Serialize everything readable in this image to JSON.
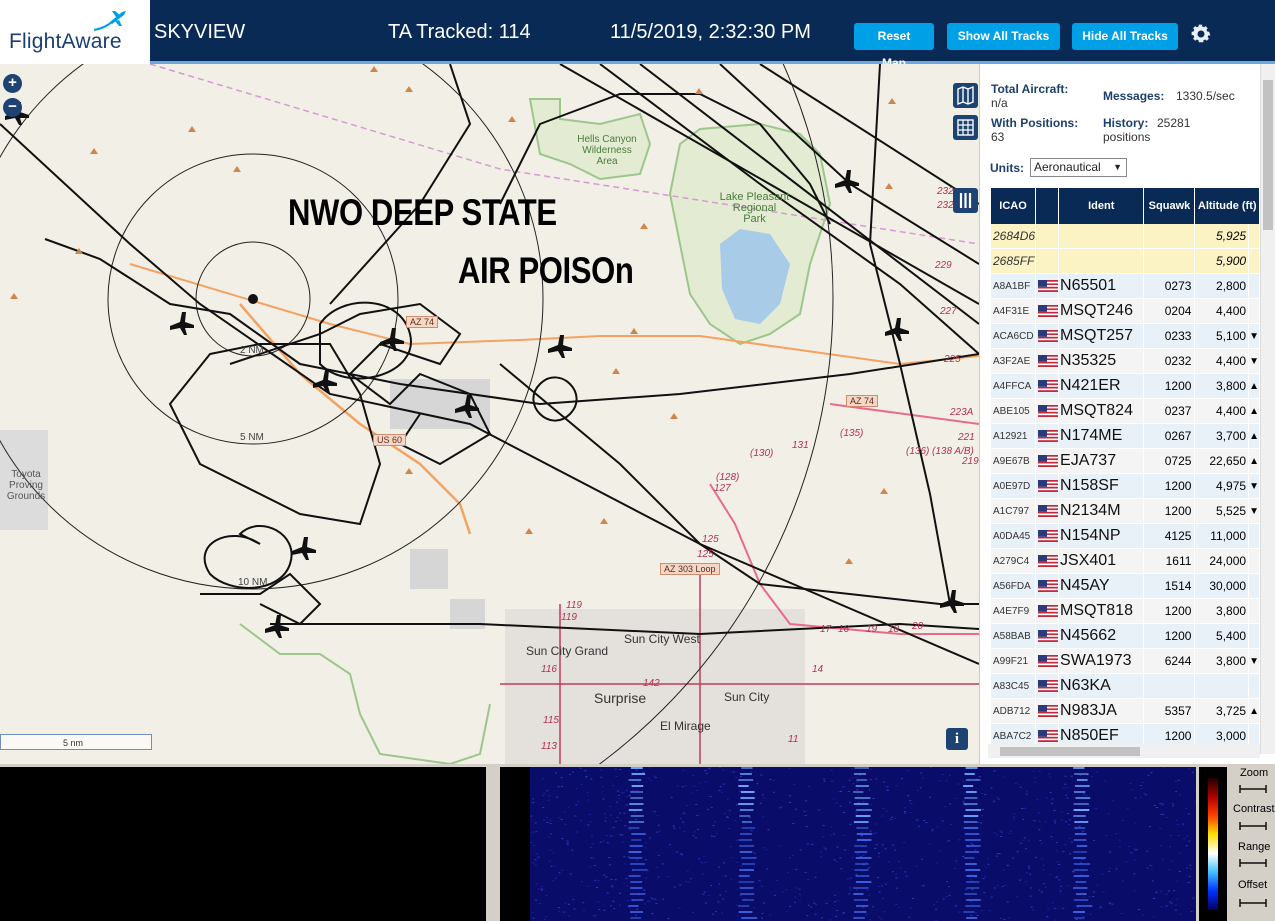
{
  "header": {
    "logo": "FlightAware",
    "app_name": "SKYVIEW",
    "tracked": "TA Tracked: 114",
    "clock": "11/5/2019, 2:32:30 PM",
    "buttons": {
      "reset": "Reset Map",
      "show": "Show All Tracks",
      "hide": "Hide All Tracks"
    },
    "settings_icon": "gear-icon"
  },
  "map": {
    "zoom_in": "+",
    "zoom_out": "−",
    "scale": "5 nm",
    "info": "i",
    "overlay_line_1": "NWO DEEP STATE",
    "overlay_line_2": "AIR POISOn",
    "ring_labels": [
      "2 NM",
      "5 NM",
      "10 NM"
    ],
    "places": {
      "wilderness": "Hells Canyon\nWilderness\nArea",
      "park": "Lake Pleasant\nRegional\nPark",
      "proving": "Toyota\nProving\nGrounds",
      "sun_city_west": "Sun City West",
      "sun_city_grand": "Sun City Grand",
      "surprise": "Surprise",
      "sun_city": "Sun City",
      "el_mirage": "El Mirage"
    },
    "roads": {
      "az74_a": "AZ 74",
      "az74_b": "AZ 74",
      "us60": "US 60",
      "az303": "AZ 303 Loop"
    },
    "route_numbers": [
      "131",
      "(135)",
      "(130)",
      "(128)",
      "127",
      "125",
      "125",
      "(136)",
      "(138 A/B)",
      "229",
      "227",
      "225",
      "223A",
      "221",
      "219",
      "232",
      "232",
      "119",
      "119",
      "116",
      "142",
      "115",
      "113",
      "14",
      "11",
      "17",
      "16",
      "19",
      "18",
      "20"
    ]
  },
  "sidebar": {
    "total_aircraft_label": "Total Aircraft:",
    "total_aircraft_value": "n/a",
    "with_positions_label": "With Positions:",
    "with_positions_value": "63",
    "messages_label": "Messages:",
    "messages_value": "1330.5/sec",
    "history_label": "History:",
    "history_value": "25281",
    "history_unit": "positions",
    "units_label": "Units:",
    "units_value": "Aeronautical",
    "columns": [
      "ICAO",
      "",
      "Ident",
      "Squawk",
      "Altitude (ft)"
    ],
    "rows": [
      {
        "icao": "2684D6",
        "flag": false,
        "ident": "",
        "squawk": "",
        "alt": "5,925",
        "trend": "",
        "noid": true
      },
      {
        "icao": "2685FF",
        "flag": false,
        "ident": "",
        "squawk": "",
        "alt": "5,900",
        "trend": "",
        "noid": true
      },
      {
        "icao": "A8A1BF",
        "flag": true,
        "ident": "N65501",
        "squawk": "0273",
        "alt": "2,800",
        "trend": ""
      },
      {
        "icao": "A4F31E",
        "flag": true,
        "ident": "MSQT246",
        "squawk": "0204",
        "alt": "4,400",
        "trend": ""
      },
      {
        "icao": "ACA6CD",
        "flag": true,
        "ident": "MSQT257",
        "squawk": "0233",
        "alt": "5,100",
        "trend": "▼"
      },
      {
        "icao": "A3F2AE",
        "flag": true,
        "ident": "N35325",
        "squawk": "0232",
        "alt": "4,400",
        "trend": "▼"
      },
      {
        "icao": "A4FFCA",
        "flag": true,
        "ident": "N421ER",
        "squawk": "1200",
        "alt": "3,800",
        "trend": "▲"
      },
      {
        "icao": "ABE105",
        "flag": true,
        "ident": "MSQT824",
        "squawk": "0237",
        "alt": "4,400",
        "trend": "▲"
      },
      {
        "icao": "A12921",
        "flag": true,
        "ident": "N174ME",
        "squawk": "0267",
        "alt": "3,700",
        "trend": "▲"
      },
      {
        "icao": "A9E67B",
        "flag": true,
        "ident": "EJA737",
        "squawk": "0725",
        "alt": "22,650",
        "trend": "▲"
      },
      {
        "icao": "A0E97D",
        "flag": true,
        "ident": "N158SF",
        "squawk": "1200",
        "alt": "4,975",
        "trend": "▼"
      },
      {
        "icao": "A1C797",
        "flag": true,
        "ident": "N2134M",
        "squawk": "1200",
        "alt": "5,525",
        "trend": "▼"
      },
      {
        "icao": "A0DA45",
        "flag": true,
        "ident": "N154NP",
        "squawk": "4125",
        "alt": "11,000",
        "trend": ""
      },
      {
        "icao": "A279C4",
        "flag": true,
        "ident": "JSX401",
        "squawk": "1611",
        "alt": "24,000",
        "trend": ""
      },
      {
        "icao": "A56FDA",
        "flag": true,
        "ident": "N45AY",
        "squawk": "1514",
        "alt": "30,000",
        "trend": ""
      },
      {
        "icao": "A4E7F9",
        "flag": true,
        "ident": "MSQT818",
        "squawk": "1200",
        "alt": "3,800",
        "trend": ""
      },
      {
        "icao": "A58BAB",
        "flag": true,
        "ident": "N45662",
        "squawk": "1200",
        "alt": "5,400",
        "trend": ""
      },
      {
        "icao": "A99F21",
        "flag": true,
        "ident": "SWA1973",
        "squawk": "6244",
        "alt": "3,800",
        "trend": "▼"
      },
      {
        "icao": "A83C45",
        "flag": true,
        "ident": "N63KA",
        "squawk": "",
        "alt": "",
        "trend": ""
      },
      {
        "icao": "ADB712",
        "flag": true,
        "ident": "N983JA",
        "squawk": "5357",
        "alt": "3,725",
        "trend": "▲"
      },
      {
        "icao": "ABA7C2",
        "flag": true,
        "ident": "N850EF",
        "squawk": "1200",
        "alt": "3,000",
        "trend": ""
      }
    ]
  },
  "spectrum": {
    "controls": [
      "Zoom",
      "Contrast",
      "Range",
      "Offset"
    ]
  },
  "colors": {
    "header_bg": "#0a2a56",
    "button_bg": "#00a0e6",
    "map_bg": "#f2efe6",
    "noid_row": "#fcf3c4"
  }
}
